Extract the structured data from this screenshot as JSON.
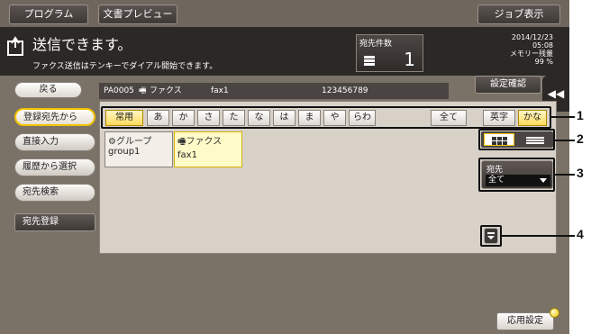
{
  "topbar": {
    "program_label": "プログラム",
    "preview_label": "文書プレビュー",
    "job_label": "ジョブ表示"
  },
  "status": {
    "title": "送信できます。",
    "message": "ファクス送信はテンキーでダイアル開始できます。",
    "dest_count_label": "宛先件数",
    "dest_count": "1",
    "date": "2014/12/23",
    "time": "05:08",
    "memory_label": "メモリー残量",
    "memory_value": "99 %"
  },
  "left_menu": {
    "back": "戻る",
    "items": [
      "登録宛先から",
      "直接入力",
      "履歴から選択",
      "宛先検索"
    ],
    "register": "宛先登録"
  },
  "path": {
    "id": "PA0005",
    "type": "ファクス",
    "name": "fax1",
    "number": "123456789"
  },
  "confirm_label": "設定確認",
  "collapse_label": "◀◀",
  "index_tabs": [
    "常用",
    "あ",
    "か",
    "さ",
    "た",
    "な",
    "は",
    "ま",
    "や",
    "らわ",
    "全て"
  ],
  "mode_tabs": [
    "英字",
    "かな"
  ],
  "addresses": [
    {
      "type": "グループ",
      "name": "group1",
      "icon": "group-icon"
    },
    {
      "type": "ファクス",
      "name": "fax1",
      "icon": "fax-icon"
    }
  ],
  "dest_filter": {
    "label": "宛先",
    "value": "全て"
  },
  "app_settings": "応用設定",
  "callouts": [
    "1",
    "2",
    "3",
    "4"
  ],
  "colors": {
    "accent": "#f2c200",
    "background": "#7a7267",
    "panel": "#d7d1c8"
  }
}
